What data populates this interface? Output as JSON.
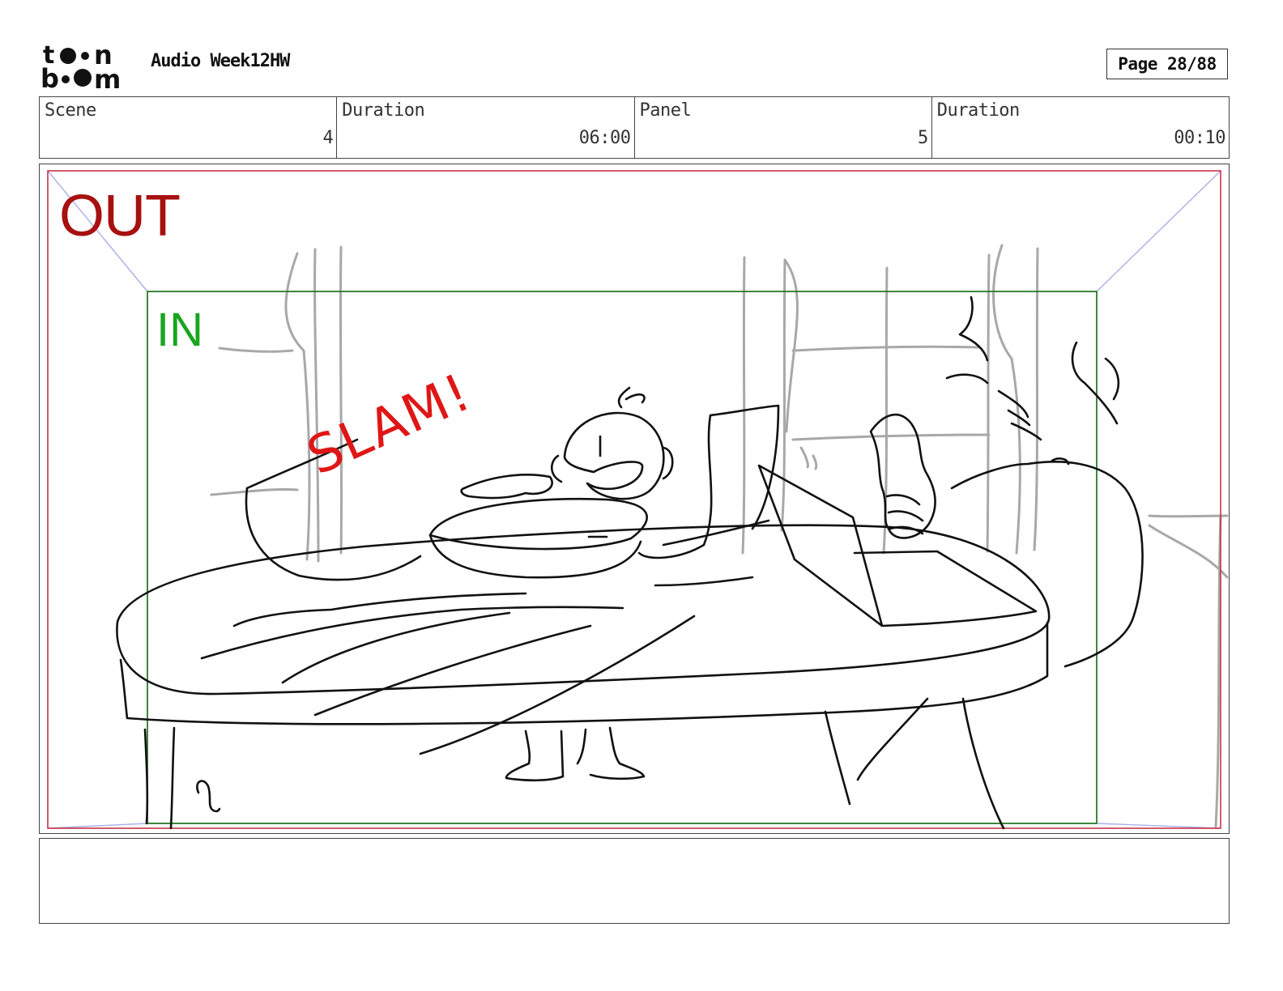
{
  "header": {
    "logo": {
      "text": "toon boom",
      "icon": "toon-boom-logo"
    },
    "title": "Audio Week12HW",
    "page_indicator": "Page 28/88"
  },
  "info": {
    "scene_label": "Scene",
    "scene_value": "4",
    "scene_duration_label": "Duration",
    "scene_duration_value": "06:00",
    "panel_label": "Panel",
    "panel_value": "5",
    "panel_duration_label": "Duration",
    "panel_duration_value": "00:10"
  },
  "panel": {
    "out_label": "OUT",
    "in_label": "IN",
    "sound_effect": "SLAM!",
    "colors": {
      "out_frame": "#c8334a",
      "out_text": "#a81010",
      "in_frame": "#2a7a2a",
      "in_text": "#19a51f",
      "camera_lines": "#aab0e8",
      "sfx": "#e01616",
      "sketch": "#111111",
      "background_sketch": "#a8a8a8"
    }
  },
  "notes": {
    "text": ""
  }
}
